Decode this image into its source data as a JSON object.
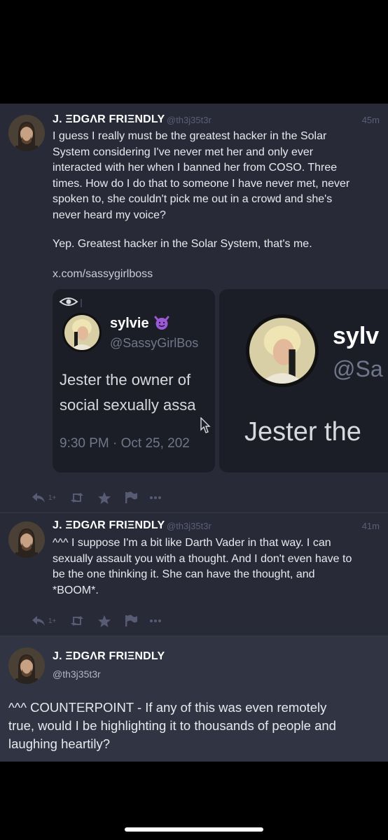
{
  "post1": {
    "author_name": "J. ΞDGΛR FRIΞNDLY",
    "author_handle": "@th3j35t3r",
    "time": "45m",
    "content_lines": [
      "I guess I really must be the greatest hacker in the Solar",
      "System considering I've never met her and only ever",
      "interacted with her when I banned her from COSO. Three",
      "times. How do I do that to someone I have never met, never",
      "spoken to, she couldn't pick me out in a crowd and she's",
      "never heard my voice?"
    ],
    "content_line2": "Yep. Greatest hacker in the Solar System, that's me.",
    "link": "x.com/sassygirlboss",
    "card1": {
      "name": "sylvie",
      "handle": "@SassyGirlBos",
      "text_line1": "Jester the owner of",
      "text_line2": "social sexually assa",
      "date": "9:30 PM · Oct 25, 202"
    },
    "card2": {
      "name": "sylv",
      "handle": "@Sa",
      "text_line1": "Jester the"
    },
    "reply_count": "1+"
  },
  "post2": {
    "author_name": "J. ΞDGΛR FRIΞNDLY",
    "author_handle": "@th3j35t3r",
    "time": "41m",
    "content_lines": [
      "^^^ I suppose I'm a bit like Darth Vader in that way. I can",
      "sexually assault you with a thought. And I don't even have to",
      "be the one thinking it. She can have the thought, and",
      "*BOOM*."
    ],
    "reply_count": "1+"
  },
  "post3": {
    "author_name": "J. ΞDGΛR FRIΞNDLY",
    "author_handle": "@th3j35t3r",
    "content_lines": [
      "^^^ COUNTERPOINT - If any of this was even remotely",
      "true, would I be highlighting it to thousands of people and",
      "laughing heartily?"
    ]
  },
  "icons": [
    "reply-icon",
    "boost-icon",
    "star-icon",
    "flag-icon",
    "more-icon",
    "eye-icon",
    "cursor-icon"
  ],
  "colors": {
    "background": "#282a37",
    "focused_post": "#313543",
    "muted": "#575b73",
    "accent_emoji": "#9b59d6"
  }
}
